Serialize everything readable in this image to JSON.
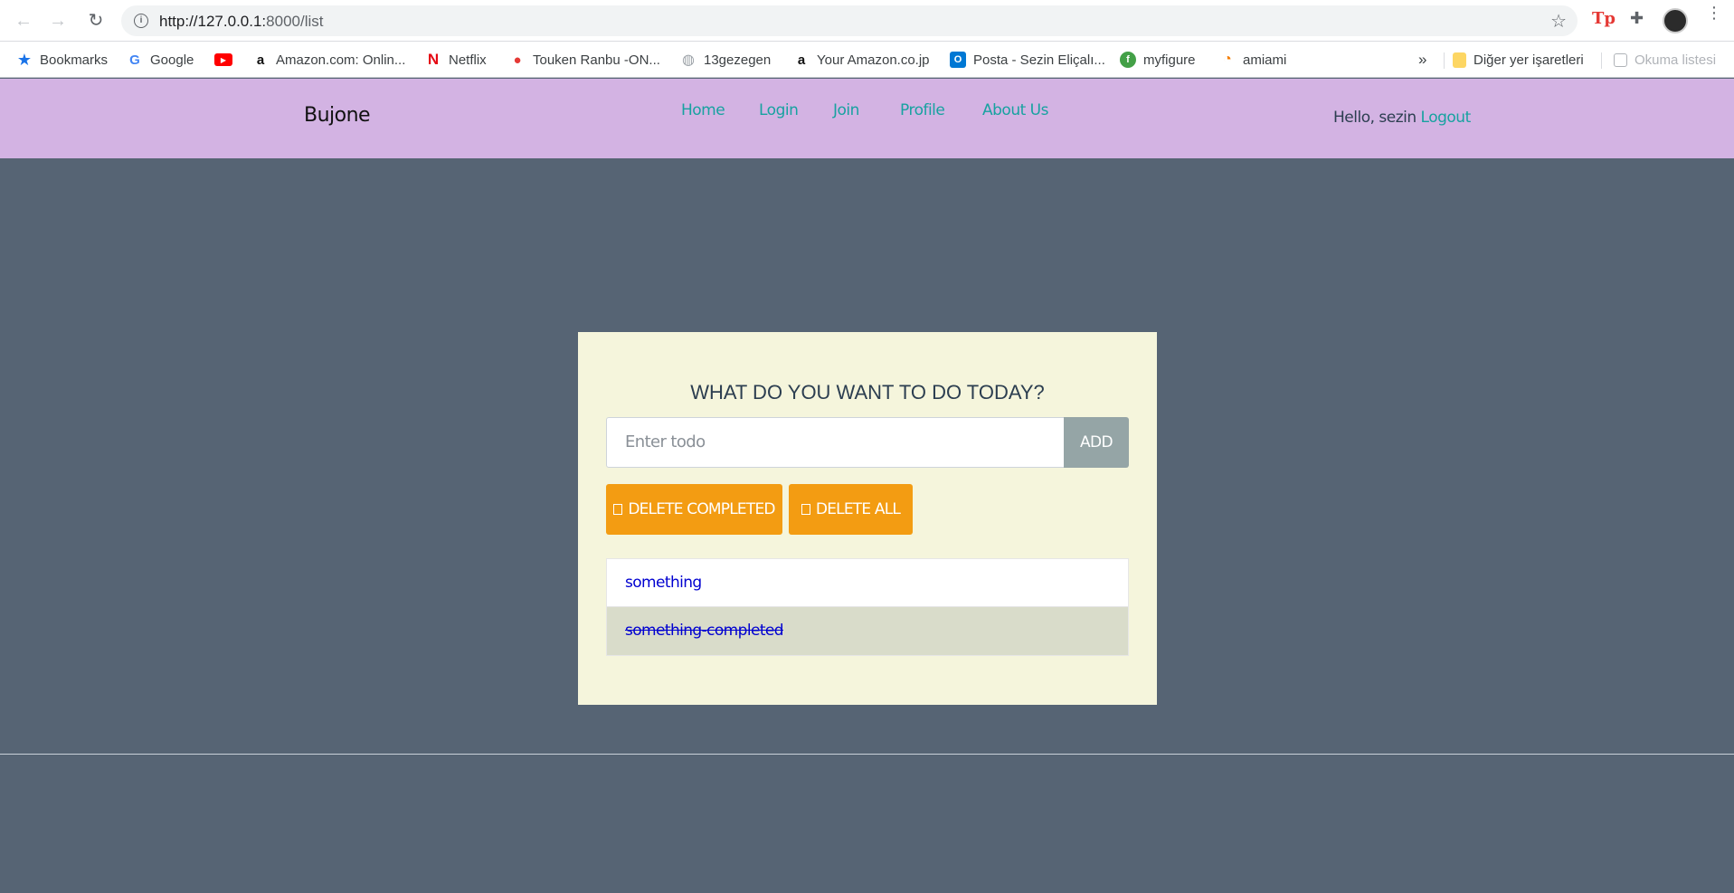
{
  "browser": {
    "url_host": "http://127.0.0.1:",
    "url_path": "8000/list",
    "bookmarks": [
      {
        "label": "Bookmarks",
        "icon": "star-icon"
      },
      {
        "label": "Google",
        "icon": "google-icon"
      },
      {
        "label": "",
        "icon": "youtube-icon"
      },
      {
        "label": "Amazon.com: Onlin...",
        "icon": "amazon-icon"
      },
      {
        "label": "Netflix",
        "icon": "netflix-icon"
      },
      {
        "label": "Touken Ranbu -ON...",
        "icon": "touken-icon"
      },
      {
        "label": "13gezegen",
        "icon": "globe-icon"
      },
      {
        "label": "Your Amazon.co.jp",
        "icon": "amazon-icon"
      },
      {
        "label": "Posta - Sezin Eliçalı...",
        "icon": "outlook-icon"
      },
      {
        "label": "myfigure",
        "icon": "myfigure-icon"
      },
      {
        "label": "amiami",
        "icon": "amiami-icon"
      }
    ],
    "overflow": "»",
    "other_bookmarks": "Diğer yer işaretleri",
    "reading_list": "Okuma listesi"
  },
  "nav": {
    "brand": "Bujone",
    "links": [
      "Home",
      "Login",
      "Join",
      "Profile",
      "About Us"
    ],
    "greeting": "Hello, sezin",
    "logout": "Logout"
  },
  "todo": {
    "heading": "WHAT DO YOU WANT TO DO TODAY?",
    "input_placeholder": "Enter todo",
    "add_label": "ADD",
    "delete_completed_label": "DELETE COMPLETED",
    "delete_all_label": "DELETE ALL",
    "items": [
      {
        "text": "something",
        "completed": false
      },
      {
        "text": "something-completed",
        "completed": true
      }
    ]
  },
  "colors": {
    "page_bg": "#566474",
    "nav_bg": "#d3b3e3",
    "card_bg": "#f5f5dc",
    "accent_link": "#17a2a0",
    "button_orange": "#f39c12",
    "button_gray": "#95a5a6"
  }
}
